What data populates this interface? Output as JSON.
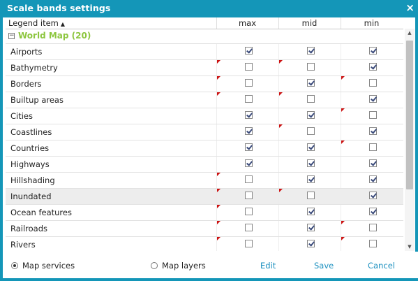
{
  "dialog": {
    "title": "Scale bands settings",
    "close_symbol": "×"
  },
  "columns": {
    "legend": "Legend item",
    "legend_sort": "▲",
    "max": "max",
    "mid": "mid",
    "min": "min"
  },
  "group": {
    "expander": "−",
    "label": "World Map (20)"
  },
  "rows": [
    {
      "name": "Airports",
      "max": true,
      "mid": true,
      "min": true,
      "flag_max": false,
      "flag_mid": false,
      "flag_min": false,
      "selected": false
    },
    {
      "name": "Bathymetry",
      "max": false,
      "mid": false,
      "min": true,
      "flag_max": true,
      "flag_mid": true,
      "flag_min": false,
      "selected": false
    },
    {
      "name": "Borders",
      "max": false,
      "mid": true,
      "min": false,
      "flag_max": true,
      "flag_mid": false,
      "flag_min": true,
      "selected": false
    },
    {
      "name": "Builtup areas",
      "max": false,
      "mid": false,
      "min": true,
      "flag_max": true,
      "flag_mid": true,
      "flag_min": false,
      "selected": false
    },
    {
      "name": "Cities",
      "max": true,
      "mid": true,
      "min": false,
      "flag_max": false,
      "flag_mid": false,
      "flag_min": true,
      "selected": false
    },
    {
      "name": "Coastlines",
      "max": true,
      "mid": false,
      "min": true,
      "flag_max": false,
      "flag_mid": true,
      "flag_min": false,
      "selected": false
    },
    {
      "name": "Countries",
      "max": true,
      "mid": true,
      "min": false,
      "flag_max": false,
      "flag_mid": false,
      "flag_min": true,
      "selected": false
    },
    {
      "name": "Highways",
      "max": true,
      "mid": true,
      "min": true,
      "flag_max": false,
      "flag_mid": false,
      "flag_min": false,
      "selected": false
    },
    {
      "name": "Hillshading",
      "max": false,
      "mid": true,
      "min": true,
      "flag_max": true,
      "flag_mid": false,
      "flag_min": false,
      "selected": false
    },
    {
      "name": "Inundated",
      "max": false,
      "mid": false,
      "min": true,
      "flag_max": true,
      "flag_mid": true,
      "flag_min": false,
      "selected": true
    },
    {
      "name": "Ocean features",
      "max": false,
      "mid": true,
      "min": true,
      "flag_max": true,
      "flag_mid": false,
      "flag_min": false,
      "selected": false
    },
    {
      "name": "Railroads",
      "max": false,
      "mid": true,
      "min": false,
      "flag_max": true,
      "flag_mid": false,
      "flag_min": true,
      "selected": false
    },
    {
      "name": "Rivers",
      "max": false,
      "mid": true,
      "min": false,
      "flag_max": true,
      "flag_mid": false,
      "flag_min": true,
      "selected": false
    }
  ],
  "scrollbar": {
    "up_symbol": "▲",
    "down_symbol": "▼"
  },
  "footer": {
    "map_services": {
      "label": "Map services",
      "selected": true
    },
    "map_layers": {
      "label": "Map layers",
      "selected": false
    },
    "edit": "Edit",
    "save": "Save",
    "cancel": "Cancel"
  },
  "colors": {
    "title_bar": "#1496b8",
    "group_label": "#8dc63f",
    "link": "#1a8fbf",
    "flag": "#cc1111"
  }
}
